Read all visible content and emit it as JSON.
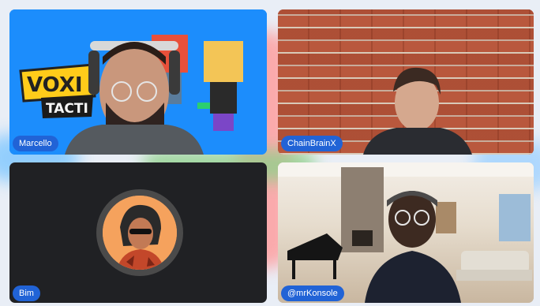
{
  "participants": [
    {
      "name": "Marcello"
    },
    {
      "name": "ChainBrainX"
    },
    {
      "name": "Bim"
    },
    {
      "name": "@mrKonsole"
    }
  ],
  "marcello_background": {
    "logo_line1": "VOXI",
    "logo_line2": "TACTI"
  },
  "colors": {
    "name_tag": "#2163d6",
    "bim_avatar": "#f5a25d",
    "tile_bg": "#202124"
  }
}
